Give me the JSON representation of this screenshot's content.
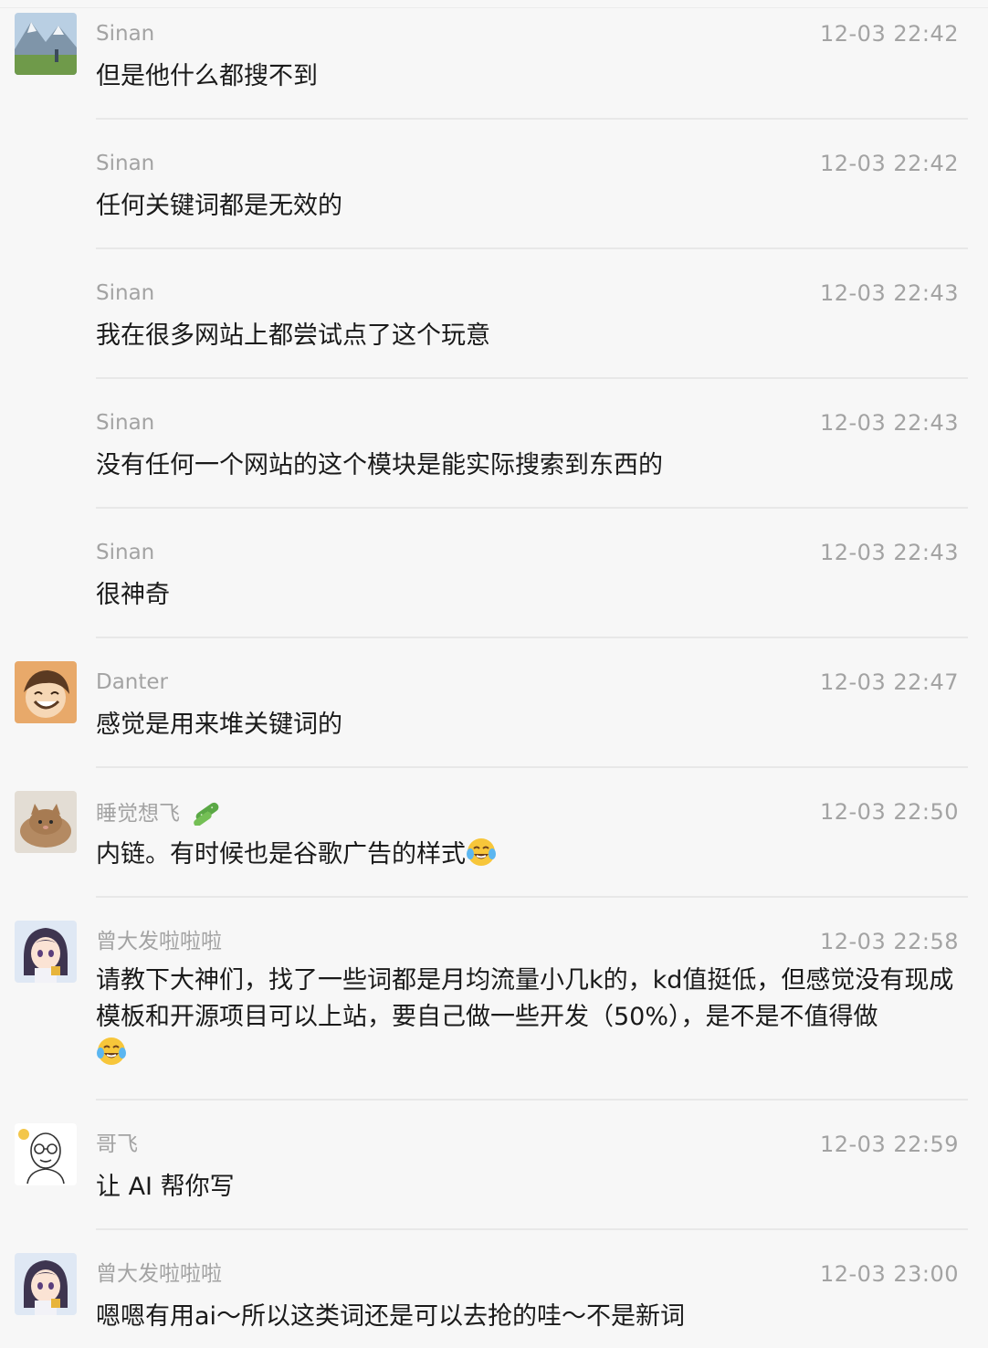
{
  "messages": [
    {
      "name": "Sinan",
      "time": "12-03 22:42",
      "text": "但是他什么都搜不到"
    },
    {
      "name": "Sinan",
      "time": "12-03 22:42",
      "text": "任何关键词都是无效的"
    },
    {
      "name": "Sinan",
      "time": "12-03 22:43",
      "text": "我在很多网站上都尝试点了这个玩意"
    },
    {
      "name": "Sinan",
      "time": "12-03 22:43",
      "text": "没有任何一个网站的这个模块是能实际搜索到东西的"
    },
    {
      "name": "Sinan",
      "time": "12-03 22:43",
      "text": "很神奇"
    },
    {
      "name": "Danter",
      "time": "12-03 22:47",
      "text": "感觉是用来堆关键词的"
    },
    {
      "name": "睡觉想飞",
      "time": "12-03 22:50",
      "text": "内链。有时候也是谷歌广告的样式",
      "trailing_emoji": "tears-of-joy-emoji",
      "name_icon": "cucumber-icon"
    },
    {
      "name": "曾大发啦啦啦",
      "time": "12-03 22:58",
      "text": "请教下大神们，找了一些词都是月均流量小几k的，kd值挺低，但感觉没有现成模板和开源项目可以上站，要自己做一些开发（50%），是不是不值得做",
      "trailing_emoji": "tears-of-joy-emoji"
    },
    {
      "name": "哥飞",
      "time": "12-03 22:59",
      "text": "让 AI 帮你写"
    },
    {
      "name": "曾大发啦啦啦",
      "time": "12-03 23:00",
      "text": "嗯嗯有用ai～所以这类词还是可以去抢的哇～不是新词"
    }
  ],
  "colors": {
    "background": "#f7f7f7",
    "meta_text": "#a3a3a3",
    "body_text": "#1a1a1a",
    "separator": "#e8e8e8"
  }
}
